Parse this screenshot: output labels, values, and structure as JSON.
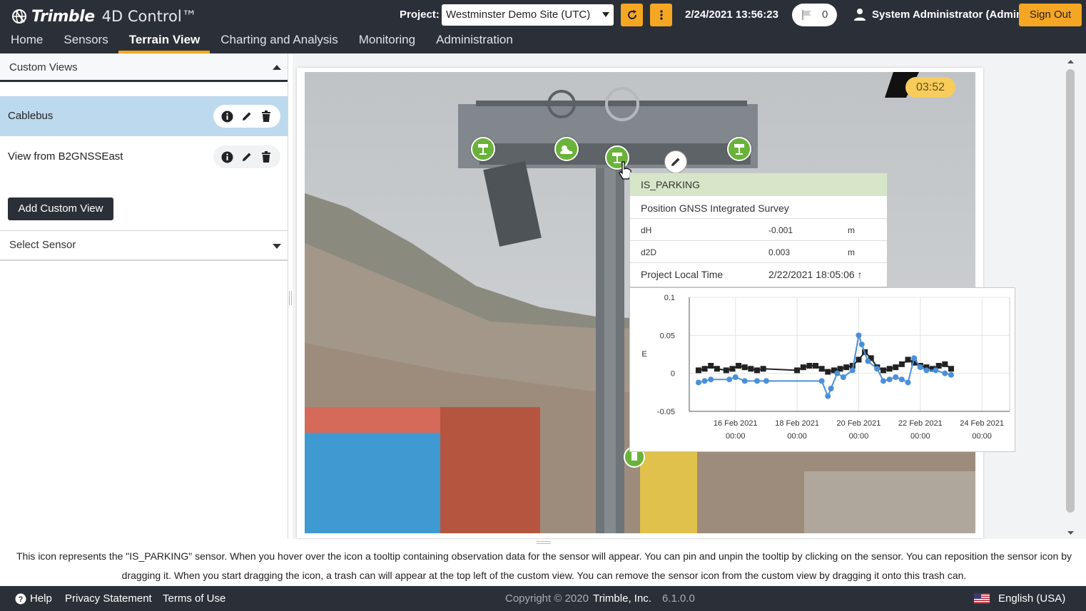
{
  "app": {
    "brand": "Trimble",
    "product": "4D Control™"
  },
  "header": {
    "project_label": "Project:",
    "project_value": "Westminster Demo Site (UTC)",
    "refresh_icon": "refresh-icon",
    "more_icon": "more-vertical-icon",
    "datetime": "2/24/2021 13:56:23",
    "flag_count": "0",
    "user": "System Administrator (Admin)",
    "signout": "Sign Out",
    "accent_color": "#f5a623",
    "bar_color": "#2b3038"
  },
  "nav": {
    "items": [
      {
        "label": "Home"
      },
      {
        "label": "Sensors"
      },
      {
        "label": "Terrain View",
        "active": true
      },
      {
        "label": "Charting and Analysis"
      },
      {
        "label": "Monitoring"
      },
      {
        "label": "Administration"
      }
    ]
  },
  "sidebar": {
    "custom_views_title": "Custom Views",
    "views": [
      {
        "label": "Cablebus",
        "selected": true
      },
      {
        "label": "View from B2GNSSEast",
        "selected": false
      }
    ],
    "add_button": "Add Custom View",
    "select_sensor": "Select Sensor"
  },
  "viewer": {
    "timer": "03:52",
    "sensor_colors": {
      "fill": "#6ab33a"
    }
  },
  "tooltip": {
    "sensor_name": "IS_PARKING",
    "sensor_type": "Position GNSS Integrated Survey",
    "rows": [
      {
        "label": "dH",
        "value": "-0.001",
        "unit": "m"
      },
      {
        "label": "d2D",
        "value": "0.003",
        "unit": "m"
      }
    ],
    "time_label": "Project Local Time",
    "time_value": "2/22/2021 18:05:06 ↑"
  },
  "chart_data": {
    "type": "line",
    "ylabel": "E",
    "ylim": [
      -0.05,
      0.1
    ],
    "yticks": [
      "0.1",
      "0.05",
      "0",
      "-0.05"
    ],
    "xticks": [
      {
        "date": "16 Feb 2021",
        "time": "00:00"
      },
      {
        "date": "18 Feb 2021",
        "time": "00:00"
      },
      {
        "date": "20 Feb 2021",
        "time": "00:00"
      },
      {
        "date": "22 Feb 2021",
        "time": "00:00"
      },
      {
        "date": "24 Feb 2021",
        "time": "00:00"
      }
    ],
    "grid": true,
    "series": [
      {
        "color": "#222222",
        "marker": "square",
        "points": [
          [
            14.8,
            0.004
          ],
          [
            15.0,
            0.006
          ],
          [
            15.2,
            0.01
          ],
          [
            15.4,
            0.006
          ],
          [
            15.7,
            0.004
          ],
          [
            15.9,
            0.006
          ],
          [
            16.1,
            0.01
          ],
          [
            16.3,
            0.008
          ],
          [
            16.5,
            0.006
          ],
          [
            16.7,
            0.004
          ],
          [
            16.9,
            0.006
          ],
          [
            18.0,
            0.004
          ],
          [
            18.2,
            0.008
          ],
          [
            18.4,
            0.01
          ],
          [
            18.6,
            0.01
          ],
          [
            18.8,
            0.006
          ],
          [
            19.0,
            0.002
          ],
          [
            19.2,
            0.004
          ],
          [
            19.4,
            0.006
          ],
          [
            19.6,
            0.008
          ],
          [
            19.8,
            0.01
          ],
          [
            20.0,
            0.018
          ],
          [
            20.2,
            0.028
          ],
          [
            20.4,
            0.02
          ],
          [
            20.6,
            0.008
          ],
          [
            20.8,
            0.004
          ],
          [
            21.0,
            0.006
          ],
          [
            21.2,
            0.008
          ],
          [
            21.4,
            0.012
          ],
          [
            21.6,
            0.018
          ],
          [
            21.8,
            0.014
          ],
          [
            22.0,
            0.01
          ],
          [
            22.2,
            0.008
          ],
          [
            22.4,
            0.006
          ],
          [
            22.6,
            0.01
          ],
          [
            22.8,
            0.012
          ],
          [
            23.0,
            0.006
          ]
        ]
      },
      {
        "color": "#4a90d9",
        "marker": "circle",
        "points": [
          [
            14.8,
            -0.012
          ],
          [
            15.0,
            -0.01
          ],
          [
            15.2,
            -0.008
          ],
          [
            15.8,
            -0.008
          ],
          [
            16.0,
            -0.005
          ],
          [
            16.3,
            -0.01
          ],
          [
            16.7,
            -0.01
          ],
          [
            17.0,
            -0.01
          ],
          [
            18.8,
            -0.01
          ],
          [
            19.0,
            -0.03
          ],
          [
            19.1,
            -0.02
          ],
          [
            19.3,
            0.0
          ],
          [
            19.5,
            -0.005
          ],
          [
            19.8,
            0.004
          ],
          [
            20.0,
            0.05
          ],
          [
            20.1,
            0.038
          ],
          [
            20.3,
            0.016
          ],
          [
            20.6,
            0.006
          ],
          [
            20.8,
            -0.01
          ],
          [
            21.0,
            -0.008
          ],
          [
            21.2,
            -0.005
          ],
          [
            21.4,
            -0.008
          ],
          [
            21.6,
            -0.012
          ],
          [
            21.8,
            0.02
          ],
          [
            22.0,
            0.008
          ],
          [
            22.2,
            0.004
          ],
          [
            22.5,
            0.004
          ],
          [
            22.8,
            0.0
          ],
          [
            23.0,
            -0.002
          ]
        ]
      }
    ]
  },
  "help_text": "This icon represents the \"IS_PARKING\" sensor. When you hover over the icon a tooltip containing observation data for the sensor will appear. You can pin and unpin the tooltip by clicking on the sensor. You can reposition the sensor icon by dragging it. When you start dragging the icon, a trash can will appear at the top left of the custom view. You can remove the sensor icon from the custom view by dragging it onto this trash can.",
  "footer": {
    "help": "Help",
    "privacy": "Privacy Statement",
    "terms": "Terms of Use",
    "copyright": "Copyright © 2020",
    "company": "Trimble, Inc.",
    "version": "6.1.0.0",
    "language": "English (USA)"
  }
}
